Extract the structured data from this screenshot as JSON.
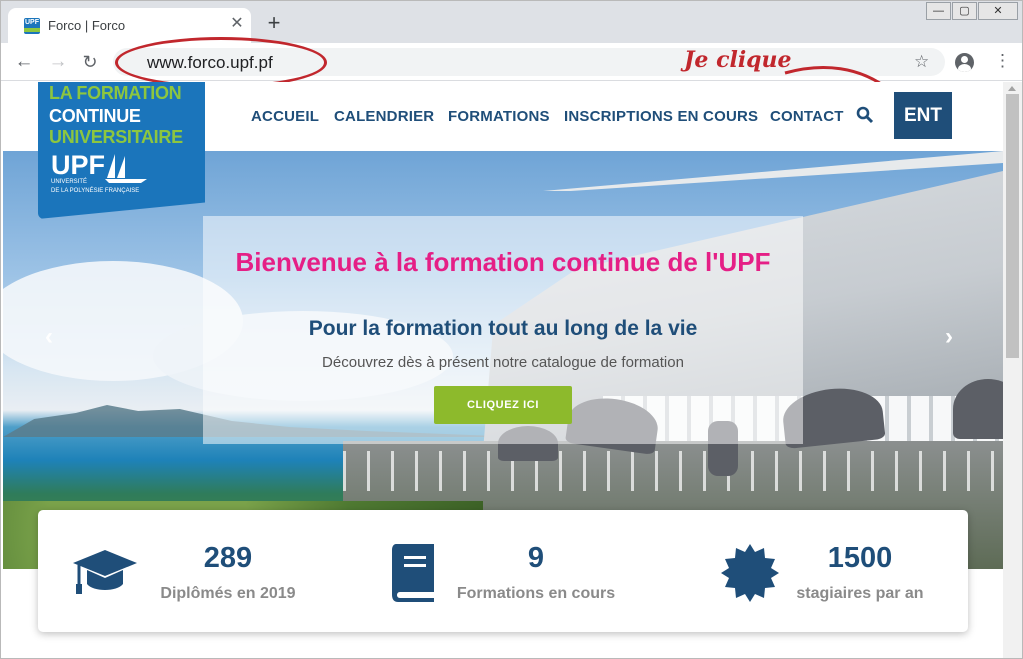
{
  "browser": {
    "tab_title": "Forco | Forco",
    "tab_close": "✕",
    "new_tab": "+",
    "favicon_text": "UPF",
    "window_minimize": "—",
    "window_maximize": "▢",
    "window_close": "✕",
    "back": "←",
    "forward": "→",
    "reload": "↻",
    "url": "www.forco.upf.pf",
    "bookmark_star": "☆",
    "menu": "⋮"
  },
  "annotation": {
    "text": "Je clique",
    "color": "#c1272d"
  },
  "logo": {
    "line1": "LA FORMATION",
    "line2": "CONTINUE",
    "line3": "UNIVERSITAIRE",
    "upf": "UPF",
    "university_line1": "UNIVERSITÉ",
    "university_line2": "DE LA POLYNÉSIE FRANÇAISE"
  },
  "nav": {
    "items": [
      "ACCUEIL",
      "CALENDRIER",
      "FORMATIONS",
      "INSCRIPTIONS EN COURS",
      "CONTACT"
    ],
    "ent": "ENT"
  },
  "hero": {
    "title": "Bienvenue à la formation continue de l'UPF",
    "subtitle": "Pour la formation tout au long de la vie",
    "description": "Découvrez dès à présent notre catalogue de formation",
    "button": "CLIQUEZ ICI",
    "prev": "‹",
    "next": "›"
  },
  "stats": [
    {
      "icon": "graduation-cap-icon",
      "value": "289",
      "label": "Diplômés en 2019"
    },
    {
      "icon": "book-icon",
      "value": "9",
      "label": "Formations en cours"
    },
    {
      "icon": "certificate-badge-icon",
      "value": "1500",
      "label": "stagiaires par an"
    }
  ],
  "colors": {
    "primary": "#1f4e79",
    "logo_blue": "#1b75bb",
    "logo_green": "#8dc63f",
    "accent_pink": "#e51f86",
    "button_green": "#8dba2c"
  }
}
